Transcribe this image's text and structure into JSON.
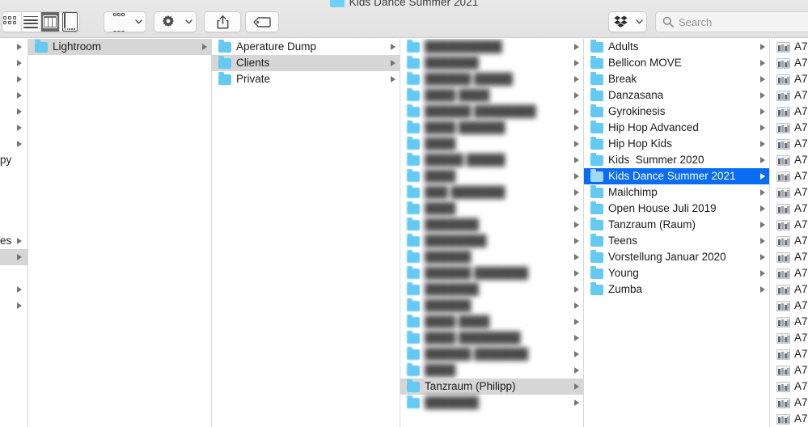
{
  "window": {
    "title": "Kids Dance Summer 2021",
    "accent_blue": "#0a6cf5",
    "selection_gray": "#d6d6d6",
    "folder_blue": "#64caf4"
  },
  "toolbar": {
    "view_modes": [
      {
        "name": "icon-view",
        "label": "Icon View",
        "active": false
      },
      {
        "name": "list-view",
        "label": "List View",
        "active": false
      },
      {
        "name": "column-view",
        "label": "Column View",
        "active": true
      },
      {
        "name": "gallery-view",
        "label": "Gallery View",
        "active": false
      }
    ],
    "group_button_label": "Group Items",
    "action_button_label": "Action",
    "share_button_label": "Share",
    "tag_button_label": "Edit Tags",
    "dropbox_button_label": "Dropbox"
  },
  "search": {
    "placeholder": "Search",
    "value": ""
  },
  "columns": [
    {
      "name": "column-0-partial",
      "items": [
        {
          "label": "",
          "arrow": true,
          "selected": false,
          "blurred": false
        },
        {
          "label": "",
          "arrow": true,
          "selected": false,
          "blurred": false
        },
        {
          "label": "",
          "arrow": true,
          "selected": false,
          "blurred": false
        },
        {
          "label": "",
          "arrow": true,
          "selected": false,
          "blurred": false
        },
        {
          "label": "",
          "arrow": true,
          "selected": false,
          "blurred": false
        },
        {
          "label": "",
          "arrow": true,
          "selected": false,
          "blurred": false
        },
        {
          "label": "",
          "arrow": true,
          "selected": false,
          "blurred": false
        },
        {
          "label": "py",
          "arrow": false,
          "selected": false,
          "blurred": false
        },
        {
          "label": "",
          "arrow": false,
          "selected": false,
          "blurred": false
        },
        {
          "label": "",
          "arrow": false,
          "selected": false,
          "blurred": false
        },
        {
          "label": "",
          "arrow": false,
          "selected": false,
          "blurred": false
        },
        {
          "label": "",
          "arrow": false,
          "selected": false,
          "blurred": false
        },
        {
          "label": "es",
          "arrow": true,
          "selected": false,
          "blurred": false
        },
        {
          "label": "",
          "arrow": true,
          "selected": true,
          "blurred": false
        },
        {
          "label": "",
          "arrow": false,
          "selected": false,
          "blurred": false
        },
        {
          "label": "",
          "arrow": true,
          "selected": false,
          "blurred": false
        },
        {
          "label": "",
          "arrow": true,
          "selected": false,
          "blurred": false
        }
      ]
    },
    {
      "name": "column-1-lightroom",
      "items": [
        {
          "label": "Lightroom",
          "arrow": true,
          "selected": true,
          "blurred": false
        }
      ]
    },
    {
      "name": "column-2-lightroom-contents",
      "items": [
        {
          "label": "Aperature Dump",
          "arrow": true,
          "selected": false,
          "blurred": false
        },
        {
          "label": "Clients",
          "arrow": true,
          "selected": true,
          "blurred": false
        },
        {
          "label": "Private",
          "arrow": true,
          "selected": false,
          "blurred": false
        }
      ]
    },
    {
      "name": "column-3-clients",
      "items": [
        {
          "label": "██████████",
          "arrow": true,
          "selected": false,
          "blurred": true
        },
        {
          "label": "███████",
          "arrow": true,
          "selected": false,
          "blurred": true
        },
        {
          "label": "██████ █████",
          "arrow": true,
          "selected": false,
          "blurred": true
        },
        {
          "label": "████ ████",
          "arrow": true,
          "selected": false,
          "blurred": true
        },
        {
          "label": "██████ ████████",
          "arrow": true,
          "selected": false,
          "blurred": true
        },
        {
          "label": "████ ██████",
          "arrow": true,
          "selected": false,
          "blurred": true
        },
        {
          "label": "████",
          "arrow": true,
          "selected": false,
          "blurred": true
        },
        {
          "label": "█████ █████",
          "arrow": true,
          "selected": false,
          "blurred": true
        },
        {
          "label": "████",
          "arrow": true,
          "selected": false,
          "blurred": true
        },
        {
          "label": "███ ███████",
          "arrow": true,
          "selected": false,
          "blurred": true
        },
        {
          "label": "████",
          "arrow": true,
          "selected": false,
          "blurred": true
        },
        {
          "label": "███████",
          "arrow": true,
          "selected": false,
          "blurred": true
        },
        {
          "label": "████████",
          "arrow": true,
          "selected": false,
          "blurred": true
        },
        {
          "label": "██████",
          "arrow": true,
          "selected": false,
          "blurred": true
        },
        {
          "label": "██████ ███████",
          "arrow": true,
          "selected": false,
          "blurred": true
        },
        {
          "label": "███████",
          "arrow": true,
          "selected": false,
          "blurred": true
        },
        {
          "label": "██████",
          "arrow": true,
          "selected": false,
          "blurred": true
        },
        {
          "label": "████ ████",
          "arrow": true,
          "selected": false,
          "blurred": true
        },
        {
          "label": "████ ████████",
          "arrow": true,
          "selected": false,
          "blurred": true
        },
        {
          "label": "██████ ███████",
          "arrow": true,
          "selected": false,
          "blurred": true
        },
        {
          "label": "████",
          "arrow": true,
          "selected": false,
          "blurred": true
        },
        {
          "label": "Tanzraum (Philipp)",
          "arrow": true,
          "selected": true,
          "blurred": false
        },
        {
          "label": "███████",
          "arrow": true,
          "selected": false,
          "blurred": true
        }
      ]
    },
    {
      "name": "column-4-tanzraum-philipp",
      "items": [
        {
          "label": "Adults",
          "arrow": true,
          "selected": false,
          "blurred": false
        },
        {
          "label": "Bellicon MOVE",
          "arrow": true,
          "selected": false,
          "blurred": false
        },
        {
          "label": "Break",
          "arrow": true,
          "selected": false,
          "blurred": false
        },
        {
          "label": "Danzasana",
          "arrow": true,
          "selected": false,
          "blurred": false
        },
        {
          "label": "Gyrokinesis",
          "arrow": true,
          "selected": false,
          "blurred": false
        },
        {
          "label": "Hip Hop Advanced",
          "arrow": true,
          "selected": false,
          "blurred": false
        },
        {
          "label": "Hip Hop Kids",
          "arrow": true,
          "selected": false,
          "blurred": false
        },
        {
          "label": "Kids  Summer 2020",
          "arrow": true,
          "selected": false,
          "blurred": false
        },
        {
          "label": "Kids Dance Summer 2021",
          "arrow": true,
          "selected": "blue",
          "blurred": false
        },
        {
          "label": "Mailchimp",
          "arrow": true,
          "selected": false,
          "blurred": false
        },
        {
          "label": "Open House Juli 2019",
          "arrow": true,
          "selected": false,
          "blurred": false
        },
        {
          "label": "Tanzraum (Raum)",
          "arrow": true,
          "selected": false,
          "blurred": false
        },
        {
          "label": "Teens",
          "arrow": true,
          "selected": false,
          "blurred": false
        },
        {
          "label": "Vorstellung Januar 2020",
          "arrow": true,
          "selected": false,
          "blurred": false
        },
        {
          "label": "Young",
          "arrow": true,
          "selected": false,
          "blurred": false
        },
        {
          "label": "Zumba",
          "arrow": true,
          "selected": false,
          "blurred": false
        }
      ]
    },
    {
      "name": "column-5-kids-dance-summer-2021-files",
      "truncated_label": "A7",
      "items": [
        {
          "label": "A7"
        },
        {
          "label": "A7"
        },
        {
          "label": "A7"
        },
        {
          "label": "A7"
        },
        {
          "label": "A7"
        },
        {
          "label": "A7"
        },
        {
          "label": "A7"
        },
        {
          "label": "A7"
        },
        {
          "label": "A7"
        },
        {
          "label": "A7"
        },
        {
          "label": "A7"
        },
        {
          "label": "A7"
        },
        {
          "label": "A7"
        },
        {
          "label": "A7"
        },
        {
          "label": "A7"
        },
        {
          "label": "A7"
        },
        {
          "label": "A7"
        },
        {
          "label": "A7"
        },
        {
          "label": "A7"
        },
        {
          "label": "A7"
        },
        {
          "label": "A7"
        },
        {
          "label": "A7"
        },
        {
          "label": "A7"
        },
        {
          "label": "A7"
        }
      ]
    }
  ]
}
